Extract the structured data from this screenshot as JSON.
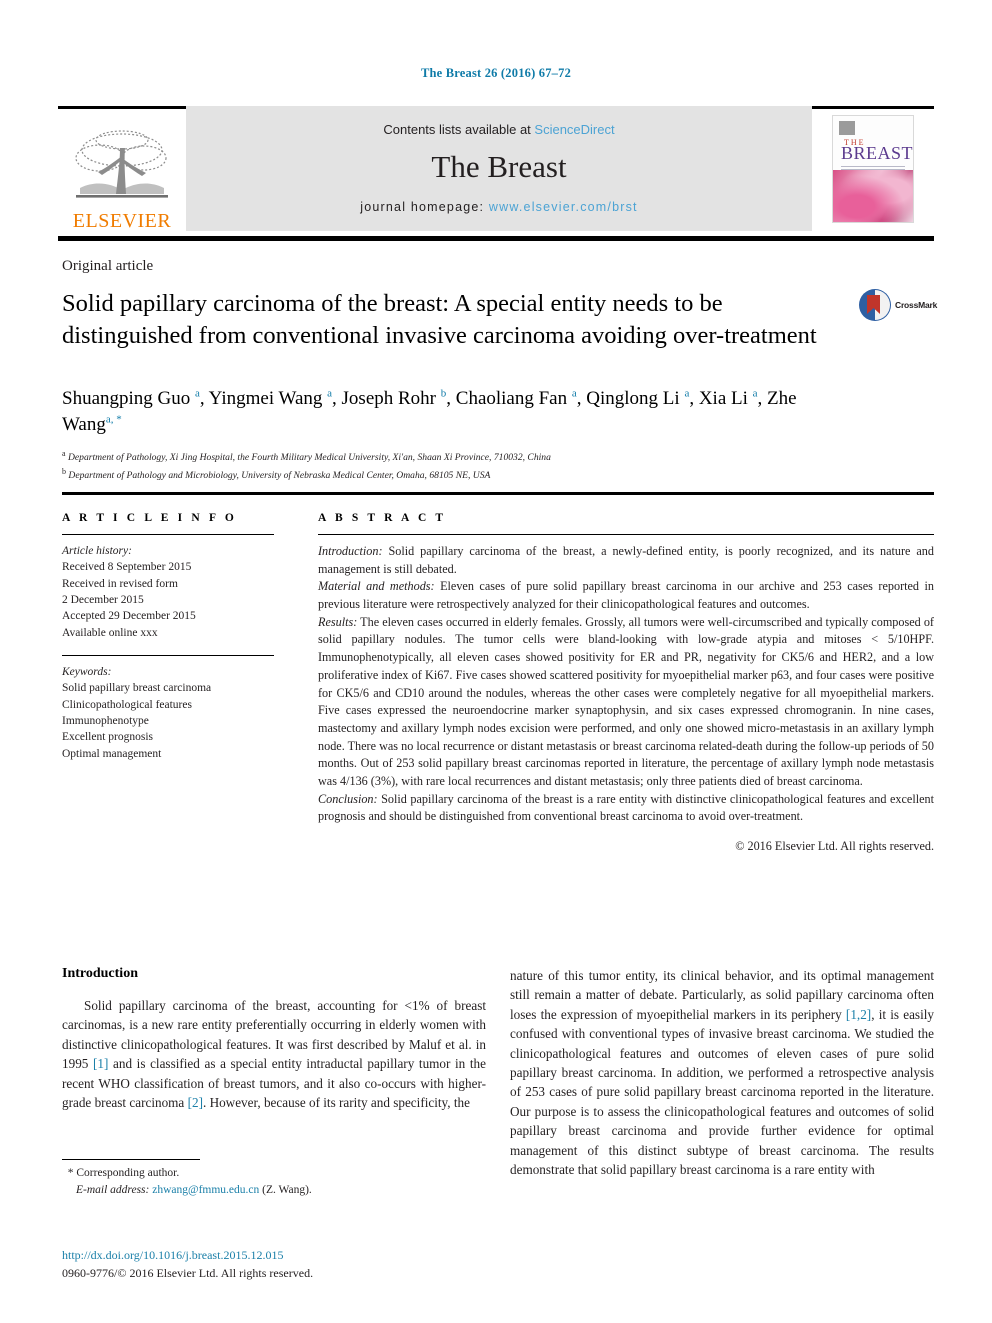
{
  "running_head": "The Breast 26 (2016) 67–72",
  "banner": {
    "publisher_name": "ELSEVIER",
    "contents_prefix": "Contents lists available at ",
    "contents_link": "ScienceDirect",
    "journal_name": "The Breast",
    "homepage_prefix": "journal homepage: ",
    "homepage_url": "www.elsevier.com/brst",
    "cover": {
      "the": "THE",
      "breast": "BREAST"
    }
  },
  "article": {
    "type": "Original article",
    "title": "Solid papillary carcinoma of the breast: A special entity needs to be distinguished from conventional invasive carcinoma avoiding over-treatment",
    "crossmark_label": "CrossMark"
  },
  "authors": {
    "line": "Shuangping Guo <sup>a</sup>, Yingmei Wang <sup>a</sup>, Joseph Rohr <sup>b</sup>, Chaoliang Fan <sup>a</sup>, Qinglong Li <sup>a</sup>, Xia Li <sup>a</sup>, Zhe Wang<sup>a, *</sup>",
    "affiliations": [
      "<sup>a</sup> Department of Pathology, Xi Jing Hospital, the Fourth Military Medical University, Xi'an, Shaan Xi Province, 710032, China",
      "<sup>b</sup> Department of Pathology and Microbiology, University of Nebraska Medical Center, Omaha, 68105 NE, USA"
    ]
  },
  "article_info": {
    "heading": "A R T I C L E   I N F O",
    "history_label": "Article history:",
    "history": [
      "Received 8 September 2015",
      "Received in revised form",
      "2 December 2015",
      "Accepted 29 December 2015",
      "Available online xxx"
    ],
    "keywords_label": "Keywords:",
    "keywords": [
      "Solid papillary breast carcinoma",
      "Clinicopathological features",
      "Immunophenotype",
      "Excellent prognosis",
      "Optimal management"
    ]
  },
  "abstract": {
    "heading": "A B S T R A C T",
    "sections": [
      {
        "lead": "Introduction:",
        "text": " Solid papillary carcinoma of the breast, a newly-defined entity, is poorly recognized, and its nature and management is still debated."
      },
      {
        "lead": "Material and methods:",
        "text": " Eleven cases of pure solid papillary breast carcinoma in our archive and 253 cases reported in previous literature were retrospectively analyzed for their clinicopathological features and outcomes."
      },
      {
        "lead": "Results:",
        "text": " The eleven cases occurred in elderly females. Grossly, all tumors were well-circumscribed and typically composed of solid papillary nodules. The tumor cells were bland-looking with low-grade atypia and mitoses < 5/10HPF. Immunophenotypically, all eleven cases showed positivity for ER and PR, negativity for CK5/6 and HER2, and a low proliferative index of Ki67. Five cases showed scattered positivity for myoepithelial marker p63, and four cases were positive for CK5/6 and CD10 around the nodules, whereas the other cases were completely negative for all myoepithelial markers. Five cases expressed the neuroendocrine marker synaptophysin, and six cases expressed chromogranin. In nine cases, mastectomy and axillary lymph nodes excision were performed, and only one showed micro-metastasis in an axillary lymph node. There was no local recurrence or distant metastasis or breast carcinoma related-death during the follow-up periods of 50 months. Out of 253 solid papillary breast carcinomas reported in literature, the percentage of axillary lymph node metastasis was 4/136 (3%), with rare local recurrences and distant metastasis; only three patients died of breast carcinoma."
      },
      {
        "lead": "Conclusion:",
        "text": " Solid papillary carcinoma of the breast is a rare entity with distinctive clinicopathological features and excellent prognosis and should be distinguished from conventional breast carcinoma to avoid over-treatment."
      }
    ],
    "copyright": "© 2016 Elsevier Ltd. All rights reserved."
  },
  "body": {
    "heading": "Introduction",
    "left_paragraph": "Solid papillary carcinoma of the breast, accounting for <1% of breast carcinomas, is a new rare entity preferentially occurring in elderly women with distinctive clinicopathological features. It was first described by Maluf et al. in 1995 <span class=\"ref\">[1]</span> and is classified as a special entity intraductal papillary tumor in the recent WHO classification of breast tumors, and it also co-occurs with higher-grade breast carcinoma <span class=\"ref\">[2]</span>. However, because of its rarity and specificity, the",
    "right_paragraph": "nature of this tumor entity, its clinical behavior, and its optimal management still remain a matter of debate. Particularly, as solid papillary carcinoma often loses the expression of myoepithelial markers in its periphery <span class=\"ref\">[1,2]</span>, it is easily confused with conventional types of invasive breast carcinoma. We studied the clinicopathological features and outcomes of eleven cases of pure solid papillary breast carcinoma. In addition, we performed a retrospective analysis of 253 cases of pure solid papillary breast carcinoma reported in the literature. Our purpose is to assess the clinicopathological features and outcomes of solid papillary breast carcinoma and provide further evidence for optimal management of this distinct subtype of breast carcinoma. The results demonstrate that solid papillary breast carcinoma is a rare entity with"
  },
  "footer": {
    "corresponding_marker": "*",
    "corresponding_label": "Corresponding author.",
    "email_label": "E-mail address:",
    "email": "zhwang@fmmu.edu.cn",
    "email_owner": "(Z. Wang).",
    "doi": "http://dx.doi.org/10.1016/j.breast.2015.12.015",
    "issn_line": "0960-9776/© 2016 Elsevier Ltd. All rights reserved."
  },
  "colors": {
    "link_blue": "#1a7fa8",
    "sciencedirect_blue": "#4ca3d4",
    "elsevier_orange": "#f07c00",
    "banner_grey": "#e3e3e3"
  }
}
